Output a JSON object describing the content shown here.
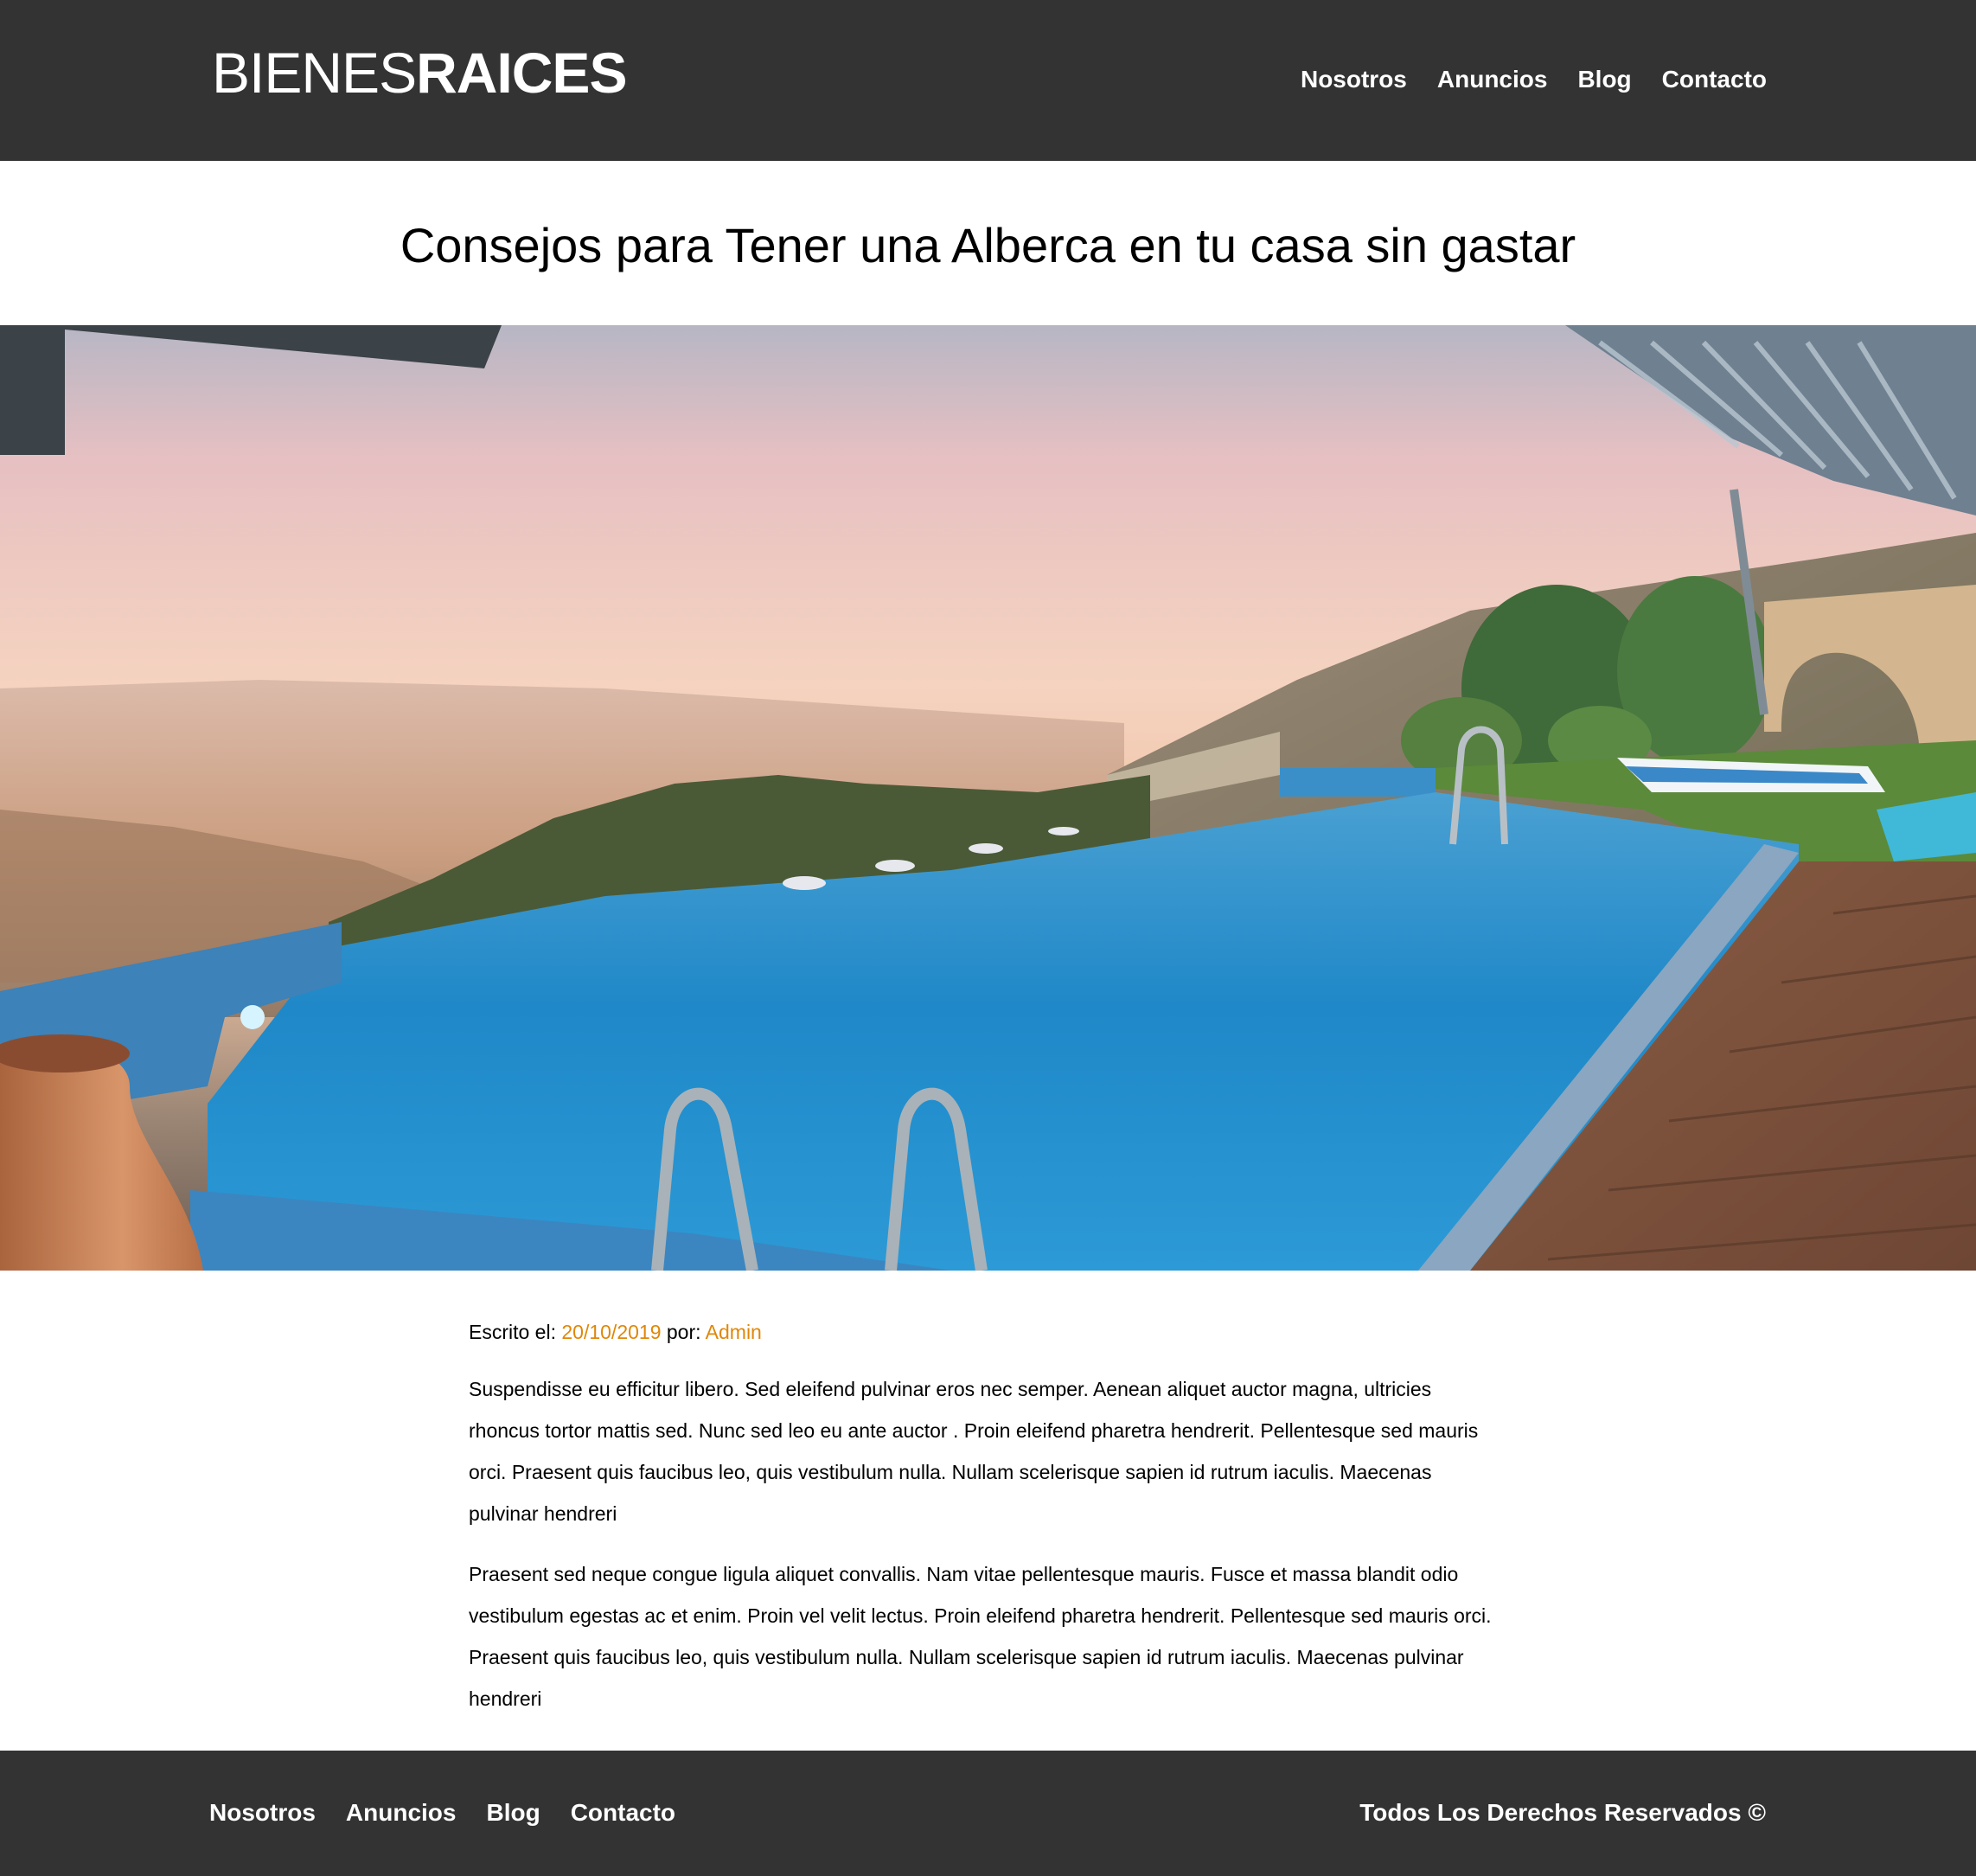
{
  "header": {
    "logo_light": "BIENES",
    "logo_bold": "RAICES",
    "nav": [
      "Nosotros",
      "Anuncios",
      "Blog",
      "Contacto"
    ]
  },
  "post": {
    "title": "Consejos para Tener una Alberca en tu casa sin gastar",
    "meta_written_label": "Escrito el: ",
    "date": "20/10/2019",
    "meta_by_label": " por: ",
    "author": "Admin",
    "paragraphs": [
      "Suspendisse eu efficitur libero. Sed eleifend pulvinar eros nec semper. Aenean aliquet auctor magna, ultricies rhoncus tortor mattis sed. Nunc sed leo eu ante auctor . Proin eleifend pharetra hendrerit. Pellentesque sed mauris orci. Praesent quis faucibus leo, quis vestibulum nulla. Nullam scelerisque sapien id rutrum iaculis. Maecenas pulvinar hendreri",
      "Praesent sed neque congue ligula aliquet convallis. Nam vitae pellentesque mauris. Fusce et massa blandit odio vestibulum egestas ac et enim. Proin vel velit lectus. Proin eleifend pharetra hendrerit. Pellentesque sed mauris orci. Praesent quis faucibus leo, quis vestibulum nulla. Nullam scelerisque sapien id rutrum iaculis. Maecenas pulvinar hendreri"
    ]
  },
  "footer": {
    "nav": [
      "Nosotros",
      "Anuncios",
      "Blog",
      "Contacto"
    ],
    "copyright": "Todos Los Derechos Reservados ©"
  },
  "colors": {
    "header_bg": "#333333",
    "footer_bg": "#333333",
    "accent": "#e08709",
    "text": "#000000"
  },
  "icons": {
    "hero": "infinity-pool-photo"
  }
}
